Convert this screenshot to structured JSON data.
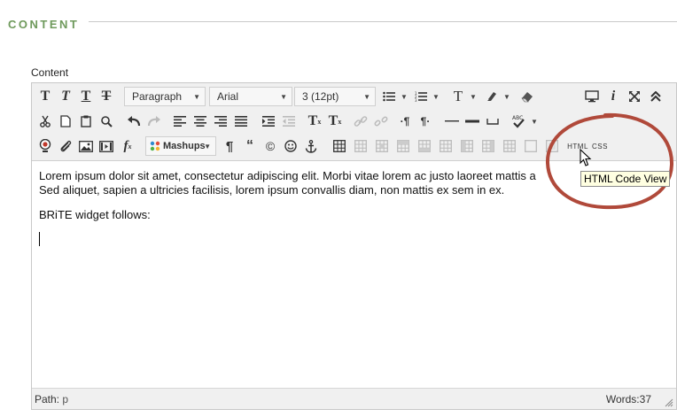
{
  "section": {
    "title": "CONTENT"
  },
  "field": {
    "label": "Content"
  },
  "toolbar": {
    "row1": {
      "format_select": "Paragraph",
      "font_select": "Arial",
      "size_select": "3 (12pt)"
    },
    "row3": {
      "mashups_label": "Mashups",
      "html_label": "HTML",
      "css_label": "CSS"
    }
  },
  "body": {
    "paragraph1": "Lorem ipsum dolor sit amet, consectetur adipiscing elit. Morbi vitae lorem ac justo laoreet mattis a",
    "paragraph1b": "Sed aliquet, sapien a ultricies facilisis, lorem ipsum convallis diam, non mattis ex sem in ex.",
    "paragraph2": "BRiTE widget follows:"
  },
  "status": {
    "path_label": "Path:",
    "path_value": "p",
    "words_label": "Words:",
    "words_value": "37"
  },
  "tooltip": {
    "text": "HTML Code View"
  },
  "colors": {
    "section_title": "#6f9a5c",
    "ring": "#b0493a",
    "tooltip_bg": "#ffffe1"
  },
  "icons": [
    "bold-icon",
    "italic-icon",
    "underline-icon",
    "strikethrough-icon",
    "bulleted-list-icon",
    "numbered-list-icon",
    "text-color-icon",
    "highlight-icon",
    "eraser-icon",
    "preview-icon",
    "info-icon",
    "fullscreen-icon",
    "collapse-icon",
    "cut-icon",
    "copy-icon",
    "paste-icon",
    "find-icon",
    "undo-icon",
    "redo-icon",
    "align-left-icon",
    "align-center-icon",
    "align-right-icon",
    "justify-icon",
    "indent-icon",
    "outdent-icon",
    "superscript-icon",
    "subscript-icon",
    "link-icon",
    "unlink-icon",
    "ltr-icon",
    "rtl-icon",
    "horizontal-rule-icon",
    "nonbreaking-space-icon",
    "spellcheck-icon",
    "record-icon",
    "attach-icon",
    "image-icon",
    "media-icon",
    "formula-icon",
    "mashups-icon",
    "paragraph-mark-icon",
    "quote-icon",
    "copyright-icon",
    "emoticon-icon",
    "anchor-icon",
    "table-icon",
    "mouse-pointer-icon",
    "resize-grip-icon"
  ]
}
